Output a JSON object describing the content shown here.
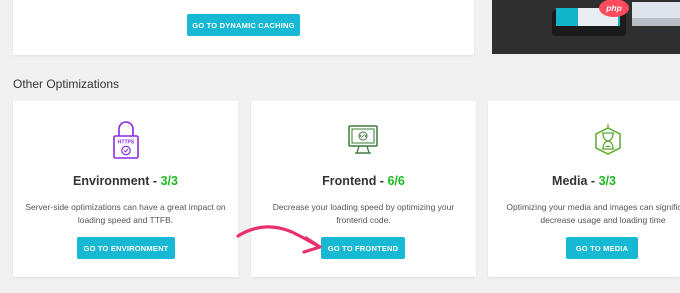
{
  "top_card": {
    "button_label": "GO TO DYNAMIC CACHING"
  },
  "promo": {
    "badge": "php"
  },
  "section_title": "Other Optimizations",
  "cards": [
    {
      "title": "Environment - ",
      "score": "3/3",
      "description": "Server-side optimizations can have a great impact on loading speed and TTFB.",
      "button_label": "GO TO ENVIRONMENT",
      "icon": "lock-https-icon"
    },
    {
      "title": "Frontend - ",
      "score": "6/6",
      "description": "Decrease your loading speed by optimizing your frontend code.",
      "button_label": "GO TO FRONTEND",
      "icon": "monitor-code-icon"
    },
    {
      "title": "Media - ",
      "score": "3/3",
      "description": "Optimizing your media and images can significantly decrease usage and loading time",
      "button_label": "GO TO MEDIA",
      "icon": "hourglass-hexagon-icon"
    }
  ],
  "colors": {
    "accent": "#17b8d3",
    "score": "#1fb81f",
    "env_icon": "#8a2be2",
    "frontend_icon": "#3c7a3c",
    "media_icon": "#5aaa2e",
    "arrow": "#e8306a"
  }
}
